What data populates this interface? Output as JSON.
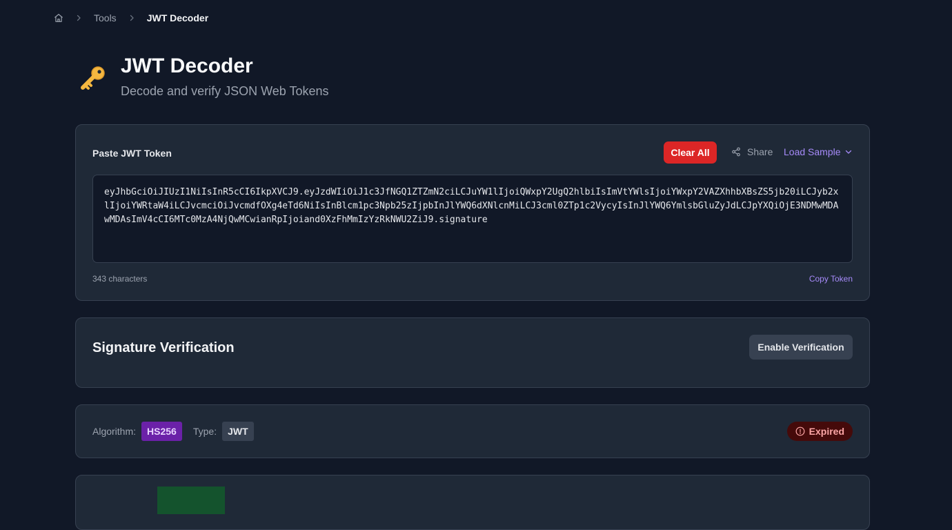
{
  "breadcrumb": {
    "home_icon": "home-icon",
    "items": [
      "Tools",
      "JWT Decoder"
    ]
  },
  "header": {
    "icon": "key-icon",
    "title": "JWT Decoder",
    "subtitle": "Decode and verify JSON Web Tokens"
  },
  "token_card": {
    "label": "Paste JWT Token",
    "clear_label": "Clear All",
    "share_label": "Share",
    "load_sample_label": "Load Sample",
    "token": "eyJhbGciOiJIUzI1NiIsInR5cCI6IkpXVCJ9.eyJzdWIiOiJ1c3JfNGQ1ZTZmN2ciLCJuYW1lIjoiQWxpY2UgQ2hlbiIsImVtYWlsIjoiYWxpY2VAZXhhbXBsZS5jb20iLCJyb2xlIjoiYWRtaW4iLCJvcmciOiJvcmdfOXg4eTd6NiIsInBlcm1pc3Npb25zIjpbInJlYWQ6dXNlcnMiLCJ3cml0ZTp1c2VycyIsInJlYWQ6YmlsbGluZyJdLCJpYXQiOjE3NDMwMDAwMDAsImV4cCI6MTc0MzA4NjQwMCwianRpIjoiand0XzFhMmIzYzRkNWU2ZiJ9.signature",
    "char_count": "343 characters",
    "copy_label": "Copy Token"
  },
  "signature": {
    "title": "Signature Verification",
    "enable_label": "Enable Verification"
  },
  "meta": {
    "algorithm_label": "Algorithm:",
    "algorithm": "HS256",
    "type_label": "Type:",
    "type": "JWT",
    "status": "Expired"
  },
  "colors": {
    "accent": "#a78bfa",
    "danger": "#dc2626",
    "background": "#111827",
    "card": "#1f2937"
  }
}
